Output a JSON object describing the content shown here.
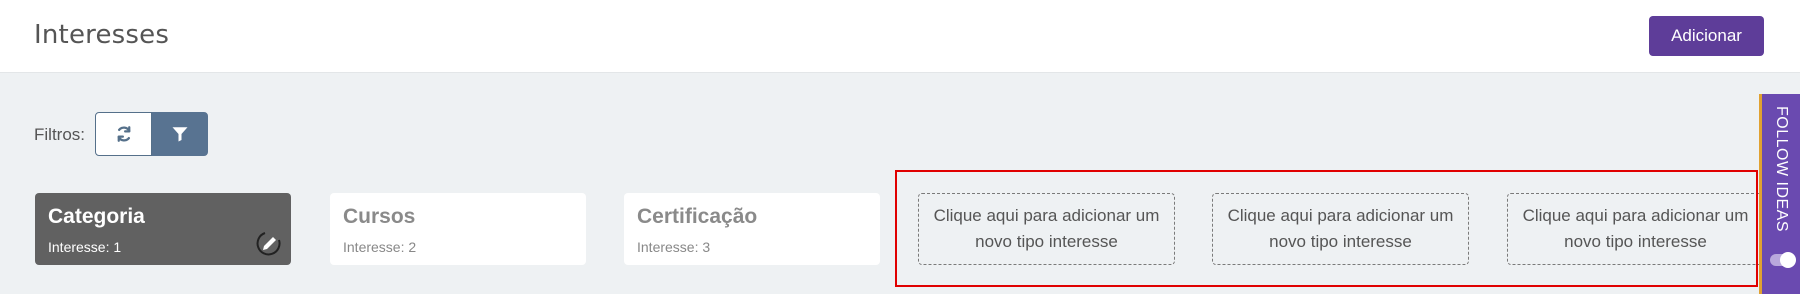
{
  "header": {
    "title": "Interesses",
    "add_label": "Adicionar"
  },
  "filters": {
    "label": "Filtros:"
  },
  "categories": [
    {
      "name": "Categoria",
      "count_label": "Interesse: 1",
      "active": true
    },
    {
      "name": "Cursos",
      "count_label": "Interesse: 2",
      "active": false
    },
    {
      "name": "Certificação",
      "count_label": "Interesse: 3",
      "active": false
    }
  ],
  "add_slots": [
    {
      "label": "Clique aqui para adicionar um novo tipo interesse"
    },
    {
      "label": "Clique aqui para adicionar um novo tipo interesse"
    },
    {
      "label": "Clique aqui para adicionar um novo tipo interesse"
    }
  ],
  "follow_tab": {
    "label": "FOLLOW IDEAS"
  },
  "colors": {
    "accent": "#5e3d99",
    "filter_button": "#587391",
    "active_card": "#616161",
    "highlight": "#e00000"
  },
  "icons": [
    "refresh-icon",
    "filter-icon",
    "edit-icon",
    "toggle-icon"
  ]
}
